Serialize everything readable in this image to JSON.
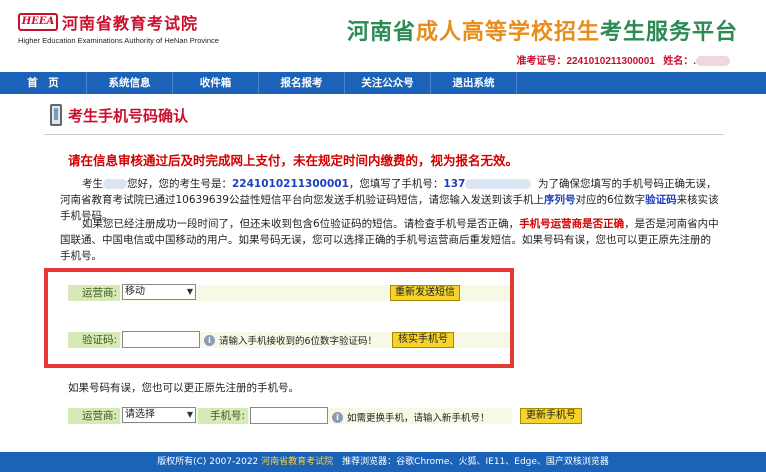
{
  "header": {
    "logo_mark": "HEEA",
    "logo_cn": "河南省教育考试院",
    "logo_en": "Higher Education Examinations Authority of HeNan Province",
    "title_part1": "河南省",
    "title_part2": "成人高等学校招生",
    "title_part3": "考生服务平台",
    "exam_no_label": "准考证号：",
    "exam_no": "2241010211300001",
    "name_label": "姓名：",
    "name_value": "."
  },
  "nav": {
    "items": [
      "首　页",
      "系统信息",
      "收件箱",
      "报名报考",
      "关注公众号",
      "退出系统"
    ]
  },
  "section": {
    "title": "考生手机号码确认"
  },
  "warning": "请在信息审核通过后及时完成网上支付，未在规定时间内缴费的，视为报名无效。",
  "paragraph1": {
    "t1": "考生",
    "t2": "您好，您的考生号是：",
    "exam_no": "2241010211300001",
    "t3": "，您填写了手机号：",
    "phone_prefix": "137",
    "t4": "为了确保您填写的手机号码正确无误，河南省教育考试院已通过10639639公益性短信平台向您发送手机验证码短信，请您输入发送到该手机上",
    "hl1": "序列号",
    "t5": "对应的6位数字",
    "hl2": "验证码",
    "t6": "来核实该手机号码。"
  },
  "paragraph2": {
    "t1": "如果您已经注册成功一段时间了，但还未收到包含6位验证码的短信。请检查手机号是否正确，",
    "hl": "手机号运营商是否正确",
    "t2": "，是否是河南省内中国联通、中国电信或中国移动的用户。如果号码无误，您可以选择正确的手机号运营商后重发短信。如果号码有误，您也可以更正原先注册的手机号。"
  },
  "form1": {
    "carrier_label": "运营商:",
    "carrier_value": "移动",
    "resend_button": "重新发送短信",
    "code_label": "验证码:",
    "code_value": "",
    "code_hint": "请输入手机接收到的6位数字验证码！",
    "verify_button": "核实手机号"
  },
  "paragraph3": "如果号码有误，您也可以更正原先注册的手机号。",
  "form2": {
    "carrier_label": "运营商:",
    "carrier_value": "请选择",
    "phone_label": "手机号:",
    "phone_value": "",
    "hint": "如需更换手机，请输入新手机号！",
    "update_button": "更新手机号"
  },
  "footer": {
    "t1": "版权所有(C) 2007-2022 ",
    "link": "河南省教育考试院",
    "t2": "　推荐浏览器：谷歌Chrome、火狐、IE11、Edge、国产双核浏览器"
  },
  "colors": {
    "nav_blue": "#1a63b8",
    "brand_red": "#c8102e",
    "title_green": "#2c8a55",
    "title_orange": "#e88d1a",
    "button_yellow": "#f6d22a",
    "highlight_box": "#e53935"
  }
}
